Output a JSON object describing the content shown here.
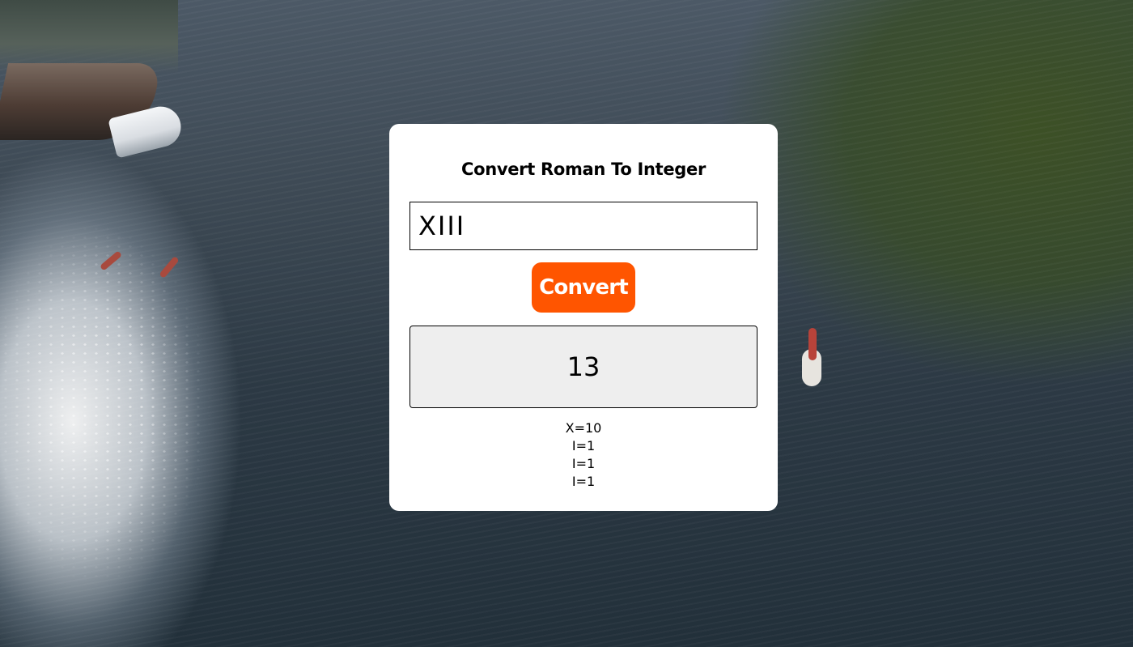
{
  "converter": {
    "title": "Convert Roman To Integer",
    "input_value": "XIII",
    "button_label": "Convert",
    "result": "13",
    "breakdown": [
      "X=10",
      "I=1",
      "I=1",
      "I=1"
    ]
  },
  "colors": {
    "accent": "#ff5500",
    "card_background": "#ffffff",
    "result_background": "#eeeeee"
  }
}
